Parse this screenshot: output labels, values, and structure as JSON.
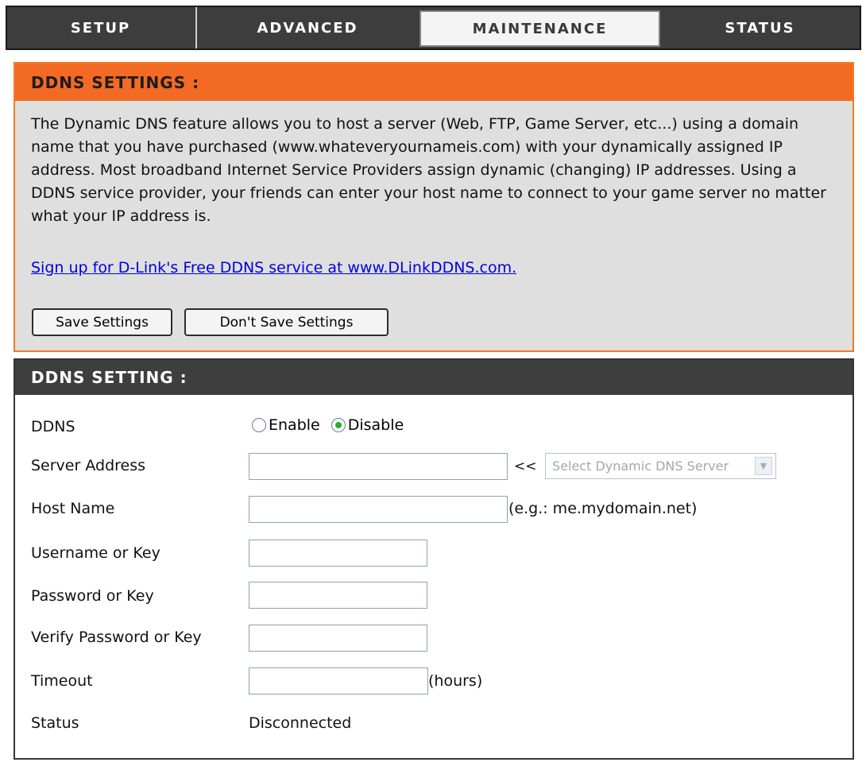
{
  "tabs": [
    {
      "label": "SETUP",
      "active": false
    },
    {
      "label": "ADVANCED",
      "active": false
    },
    {
      "label": "MAINTENANCE",
      "active": true
    },
    {
      "label": "STATUS",
      "active": false
    }
  ],
  "ddns_settings": {
    "title": "DDNS SETTINGS :",
    "description": "The Dynamic DNS feature allows you to host a server (Web, FTP, Game Server, etc...) using a domain name that you have purchased (www.whateveryournameis.com) with your dynamically assigned IP address. Most broadband Internet Service Providers assign dynamic (changing) IP addresses. Using a DDNS service provider, your friends can enter your host name to connect to your game server no matter what your IP address is.",
    "signup_link": "Sign up for D-Link's Free DDNS service at www.DLinkDDNS.com.",
    "save_button": "Save Settings",
    "dont_save_button": "Don't Save Settings"
  },
  "ddns_setting": {
    "title": "DDNS SETTING :",
    "ddns_label": "DDNS",
    "enable_label": "Enable",
    "disable_label": "Disable",
    "ddns_selected": "Disable",
    "server_address_label": "Server Address",
    "server_address_value": "",
    "server_select_arrow": "<<",
    "server_select_value": "Select Dynamic DNS Server",
    "host_name_label": "Host Name",
    "host_name_value": "",
    "host_name_hint": "(e.g.: me.mydomain.net)",
    "username_label": "Username or Key",
    "username_value": "",
    "password_label": "Password or Key",
    "password_value": "",
    "verify_password_label": "Verify Password or Key",
    "verify_password_value": "",
    "timeout_label": "Timeout",
    "timeout_value": "",
    "timeout_unit": "(hours)",
    "status_label": "Status",
    "status_value": "Disconnected"
  }
}
